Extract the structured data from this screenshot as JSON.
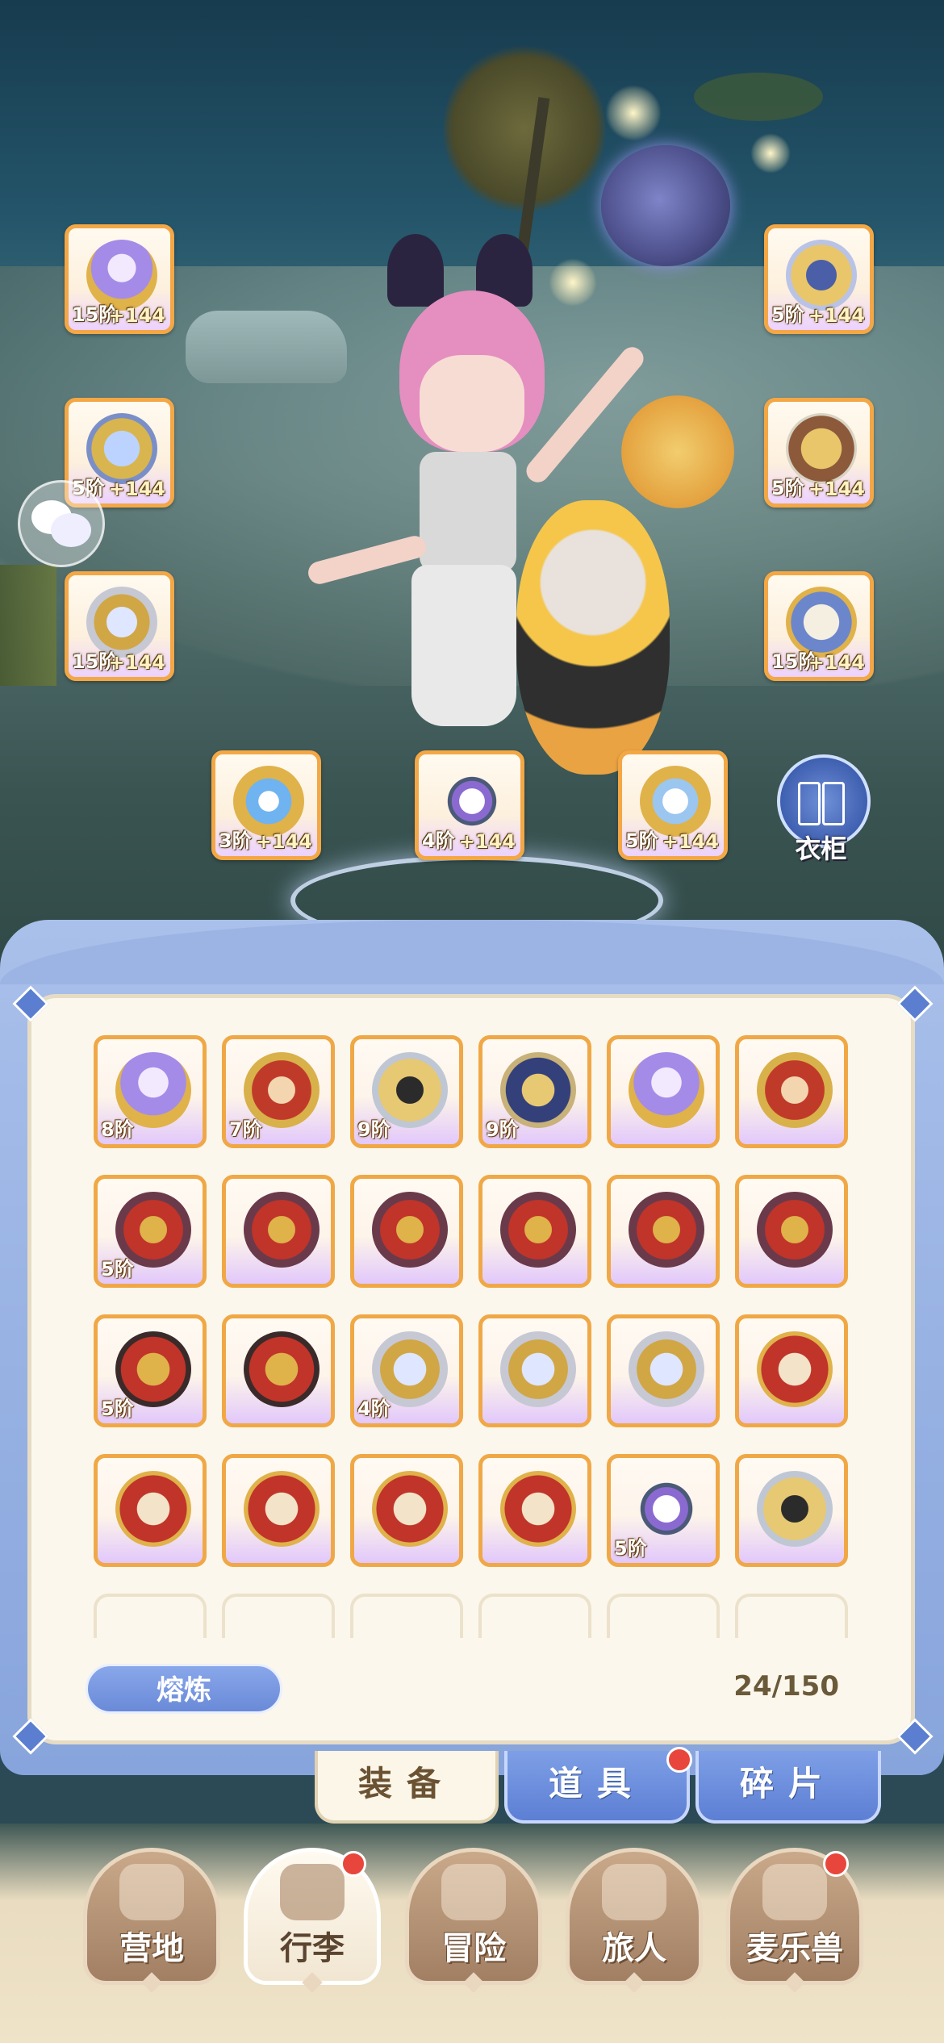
{
  "character_equipment": [
    {
      "slot": "left-1",
      "icon": "orb-scepter-icon",
      "tier": "15阶",
      "plus": "+144"
    },
    {
      "slot": "left-2",
      "icon": "chest-armor-icon",
      "tier": "5阶",
      "plus": "+144"
    },
    {
      "slot": "left-3",
      "icon": "leg-armor-icon",
      "tier": "15阶",
      "plus": "+144"
    },
    {
      "slot": "right-1",
      "icon": "helmet-icon",
      "tier": "5阶",
      "plus": "+144"
    },
    {
      "slot": "right-2",
      "icon": "gauntlet-icon",
      "tier": "5阶",
      "plus": "+144"
    },
    {
      "slot": "right-3",
      "icon": "boots-icon",
      "tier": "15阶",
      "plus": "+144"
    },
    {
      "slot": "bottom-1",
      "icon": "ring-icon",
      "tier": "3阶",
      "plus": "+144"
    },
    {
      "slot": "bottom-2",
      "icon": "necklace-icon",
      "tier": "4阶",
      "plus": "+144"
    },
    {
      "slot": "bottom-3",
      "icon": "amulet-icon",
      "tier": "5阶",
      "plus": "+144"
    }
  ],
  "wardrobe": {
    "label": "衣柜",
    "icon": "wardrobe-icon"
  },
  "inventory": {
    "items": [
      {
        "icon": "orb-scepter-icon",
        "tier": "8阶"
      },
      {
        "icon": "red-helmet-icon",
        "tier": "7阶"
      },
      {
        "icon": "gold-helmet-icon",
        "tier": "9阶"
      },
      {
        "icon": "blue-gauntlet-icon",
        "tier": "9阶"
      },
      {
        "icon": "orb-scepter-icon",
        "tier": ""
      },
      {
        "icon": "red-helmet-icon",
        "tier": ""
      },
      {
        "icon": "red-chest-armor-icon",
        "tier": "5阶"
      },
      {
        "icon": "red-chest-armor-icon",
        "tier": ""
      },
      {
        "icon": "red-chest-armor-icon",
        "tier": ""
      },
      {
        "icon": "red-chest-armor-icon",
        "tier": ""
      },
      {
        "icon": "red-chest-armor-icon",
        "tier": ""
      },
      {
        "icon": "red-chest-armor-icon",
        "tier": ""
      },
      {
        "icon": "red-gauntlet-icon",
        "tier": "5阶"
      },
      {
        "icon": "red-gauntlet-icon",
        "tier": ""
      },
      {
        "icon": "leg-armor-icon",
        "tier": "4阶"
      },
      {
        "icon": "leg-armor-icon",
        "tier": ""
      },
      {
        "icon": "leg-armor-icon",
        "tier": ""
      },
      {
        "icon": "red-boots-icon",
        "tier": ""
      },
      {
        "icon": "red-boots-icon",
        "tier": ""
      },
      {
        "icon": "red-boots-icon",
        "tier": ""
      },
      {
        "icon": "red-boots-icon",
        "tier": ""
      },
      {
        "icon": "red-boots-icon",
        "tier": ""
      },
      {
        "icon": "necklace-icon",
        "tier": "5阶"
      },
      {
        "icon": "gold-helmet-icon",
        "tier": ""
      }
    ],
    "empty_slots": 6,
    "smelt_label": "熔炼",
    "count": "24/150"
  },
  "category_tabs": [
    {
      "label": "装备",
      "active": true,
      "badge": false
    },
    {
      "label": "道具",
      "active": false,
      "badge": true
    },
    {
      "label": "碎片",
      "active": false,
      "badge": false
    }
  ],
  "bottom_nav": [
    {
      "label": "营地",
      "icon": "castle-icon",
      "active": false,
      "badge": false
    },
    {
      "label": "行李",
      "icon": "backpack-icon",
      "active": true,
      "badge": true
    },
    {
      "label": "冒险",
      "icon": "crossed-swords-icon",
      "active": false,
      "badge": false
    },
    {
      "label": "旅人",
      "icon": "traveler-portrait-icon",
      "active": false,
      "badge": false
    },
    {
      "label": "麦乐兽",
      "icon": "fox-pet-icon",
      "active": false,
      "badge": true
    }
  ],
  "colors": {
    "slot_border": "#f0a846",
    "panel_frame": "#9cb4e4",
    "tab_active": "#fbf6e8",
    "tab_inactive": "#6f8fdc",
    "badge": "#e8463c"
  }
}
